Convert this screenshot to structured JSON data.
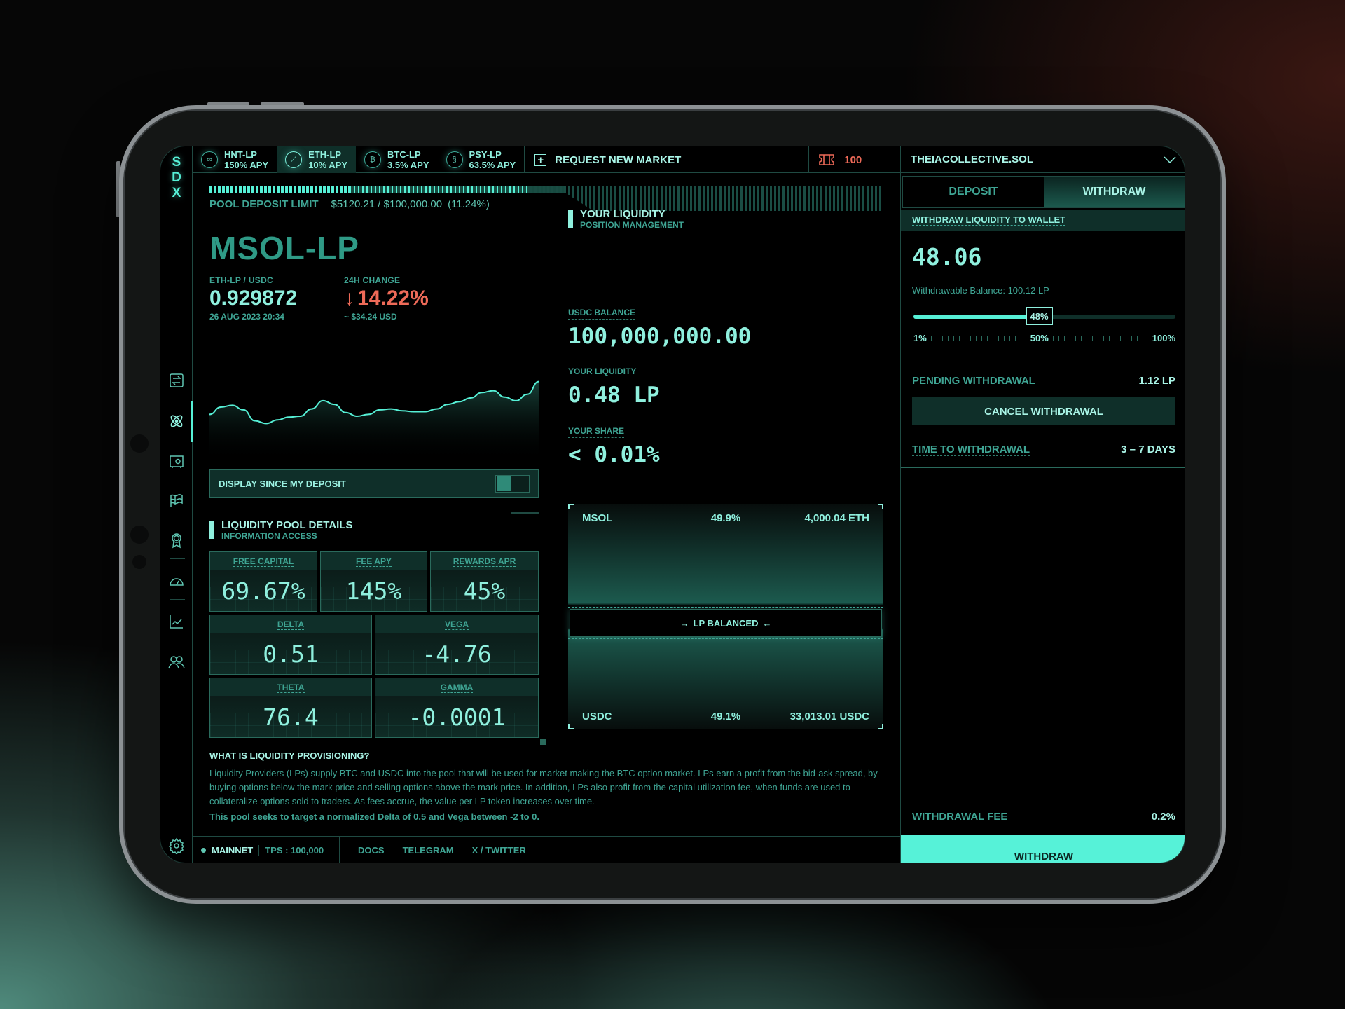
{
  "app": {
    "logo": [
      "S",
      "D",
      "X"
    ]
  },
  "markets": [
    {
      "name": "HNT-LP",
      "apy": "150% APY",
      "icon": "hnt-icon",
      "glyph": "∞",
      "active": false
    },
    {
      "name": "ETH-LP",
      "apy": "10% APY",
      "icon": "eth-icon",
      "glyph": "⟋",
      "active": true
    },
    {
      "name": "BTC-LP",
      "apy": "3.5% APY",
      "icon": "btc-icon",
      "glyph": "₿",
      "active": false
    },
    {
      "name": "PSY-LP",
      "apy": "63.5% APY",
      "icon": "psy-icon",
      "glyph": "§",
      "active": false
    }
  ],
  "topbar": {
    "request_market": "REQUEST NEW MARKET",
    "plus_glyph": "+",
    "ticket_count": "100"
  },
  "deposit_limit": {
    "label": "POOL DEPOSIT LIMIT",
    "value": "$5120.21 / $100,000.00",
    "percent_text": "(11.24%)",
    "fill_fraction": 0.4
  },
  "pool": {
    "title": "MSOL-LP",
    "pair_label": "ETH-LP / USDC",
    "price": "0.929872",
    "timestamp": "26 AUG 2023 20:34",
    "change_label": "24H CHANGE",
    "change_arrow": "↓",
    "change_value": "14.22%",
    "change_usd": "~ $34.24 USD"
  },
  "chart_data": {
    "type": "area",
    "title": "",
    "xlabel": "",
    "ylabel": "",
    "values": [
      52,
      60,
      62,
      57,
      45,
      42,
      46,
      49,
      50,
      58,
      67,
      63,
      54,
      50,
      52,
      57,
      58,
      56,
      55,
      55,
      58,
      63,
      66,
      70,
      76,
      78,
      71,
      67,
      74,
      88
    ],
    "ylim": [
      0,
      100
    ],
    "grid": false,
    "color": "#56f0d6"
  },
  "toggle": {
    "label": "DISPLAY SINCE MY DEPOSIT",
    "on": false
  },
  "details": {
    "title": "LIQUIDITY POOL DETAILS",
    "subtitle": "INFORMATION ACCESS",
    "stats_top": [
      {
        "label": "FREE CAPITAL",
        "value": "69.67%"
      },
      {
        "label": "FEE APY",
        "value": "145%"
      },
      {
        "label": "REWARDS APR",
        "value": "45%"
      }
    ],
    "greeks": [
      {
        "label": "DELTA",
        "value": "0.51"
      },
      {
        "label": "VEGA",
        "value": "-4.76"
      },
      {
        "label": "THETA",
        "value": "76.4"
      },
      {
        "label": "GAMMA",
        "value": "-0.0001"
      }
    ]
  },
  "info": {
    "question": "WHAT IS LIQUIDITY PROVISIONING?",
    "body": "Liquidity Providers (LPs) supply BTC and USDC into the pool that will be used for market making the BTC option market. LPs earn a profit from the bid-ask spread, by buying options below the mark price and selling options above the mark price. In addition, LPs also profit from the capital utilization fee, when funds are used to collateralize options sold to traders. As fees accrue, the value per LP token increases over time.",
    "target": "This pool seeks to target a normalized Delta of 0.5 and Vega between -2 to 0."
  },
  "footer": {
    "network": "MAINNET",
    "tps": "TPS : 100,000",
    "links": [
      "DOCS",
      "TELEGRAM",
      "X / TWITTER"
    ]
  },
  "your_liquidity": {
    "title": "YOUR LIQUIDITY",
    "subtitle": "POSITION MANAGEMENT",
    "usdc_balance_label": "USDC BALANCE",
    "usdc_balance": "100,000,000.00",
    "liquidity_label": "YOUR LIQUIDITY",
    "liquidity": "0.48 LP",
    "share_label": "YOUR SHARE",
    "share": "< 0.01%"
  },
  "balance": {
    "top": {
      "asset": "MSOL",
      "percent": "49.9%",
      "amount": "4,000.04 ETH"
    },
    "status": "LP BALANCED",
    "arrow_right": "→",
    "arrow_left": "←",
    "bottom": {
      "asset": "USDC",
      "percent": "49.1%",
      "amount": "33,013.01 USDC"
    }
  },
  "account": {
    "name": "THEIACOLLECTIVE.SOL"
  },
  "panel": {
    "tabs": [
      {
        "label": "DEPOSIT",
        "active": false
      },
      {
        "label": "WITHDRAW",
        "active": true
      }
    ],
    "section": "WITHDRAW LIQUIDITY TO WALLET",
    "amount": "48.06",
    "withdrawable": "Withdrawable Balance: 100.12 LP",
    "slider_percent": 48,
    "slider_label": "48%",
    "slider_ticks": [
      "1%",
      "50%",
      "100%"
    ],
    "pending_label": "PENDING WITHDRAWAL",
    "pending_value": "1.12 LP",
    "cancel_label": "CANCEL WITHDRAWAL",
    "time_label": "TIME TO WITHDRAWAL",
    "time_value": "3 – 7 DAYS",
    "fee_label": "WITHDRAWAL FEE",
    "fee_value": "0.2%",
    "submit_label": "WITHDRAW"
  },
  "colors": {
    "accent": "#56f0d6",
    "text": "#8ff0de",
    "muted": "#3fa594",
    "negative": "#ee6a58",
    "panel": "#0f2f29"
  }
}
